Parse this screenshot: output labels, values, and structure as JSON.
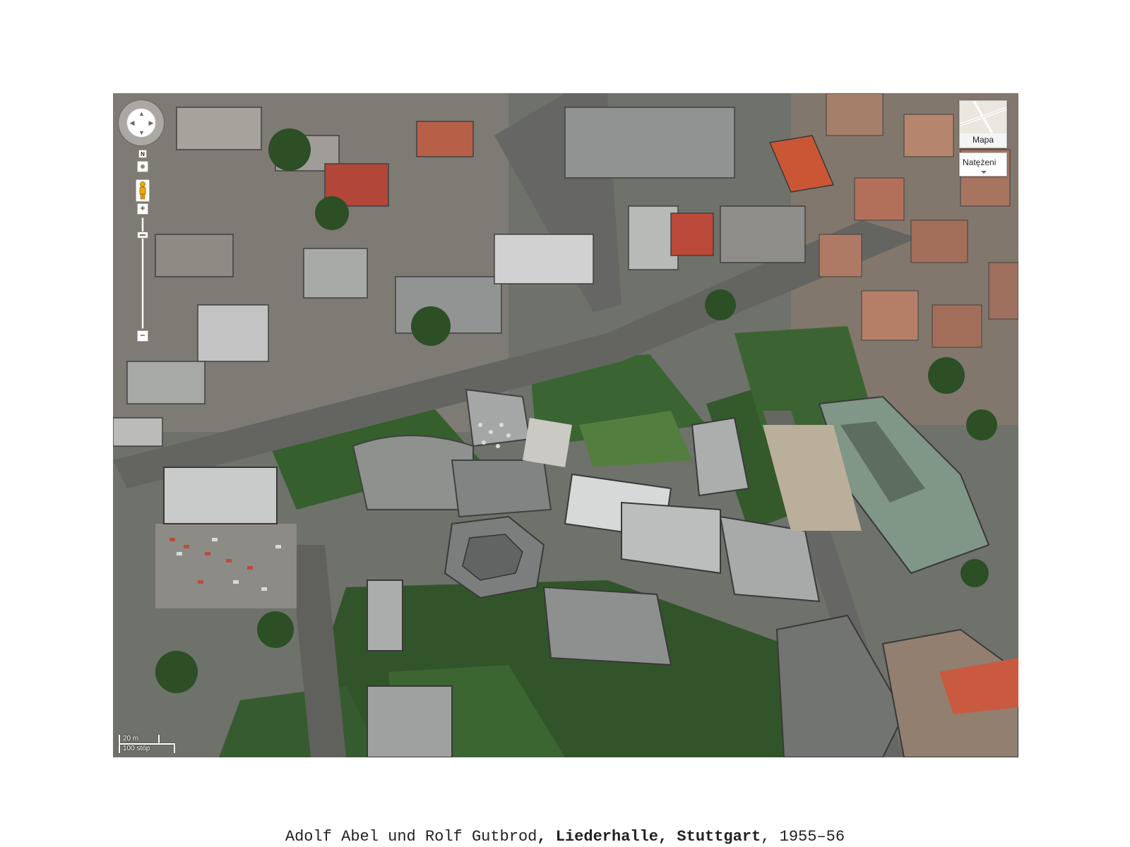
{
  "map": {
    "map_type_label": "Mapa",
    "traffic_label": "Natężeni",
    "north_label": "N",
    "zoom_in_label": "+",
    "zoom_out_label": "−",
    "scale_metric": "20 m",
    "scale_imperial": "100 stóp",
    "colors": {
      "vegetation": "#2f5a26",
      "roof_gray": "#8c8f8d",
      "road": "#6d6e6a",
      "red_roof": "#c84a2a"
    }
  },
  "caption": {
    "authors": "Adolf Abel und Rolf Gutbrod",
    "sep1": ", ",
    "building": "Liederhalle",
    "sep2": ", ",
    "city": "Stuttgart",
    "sep3": ", ",
    "years": "1955–56"
  }
}
